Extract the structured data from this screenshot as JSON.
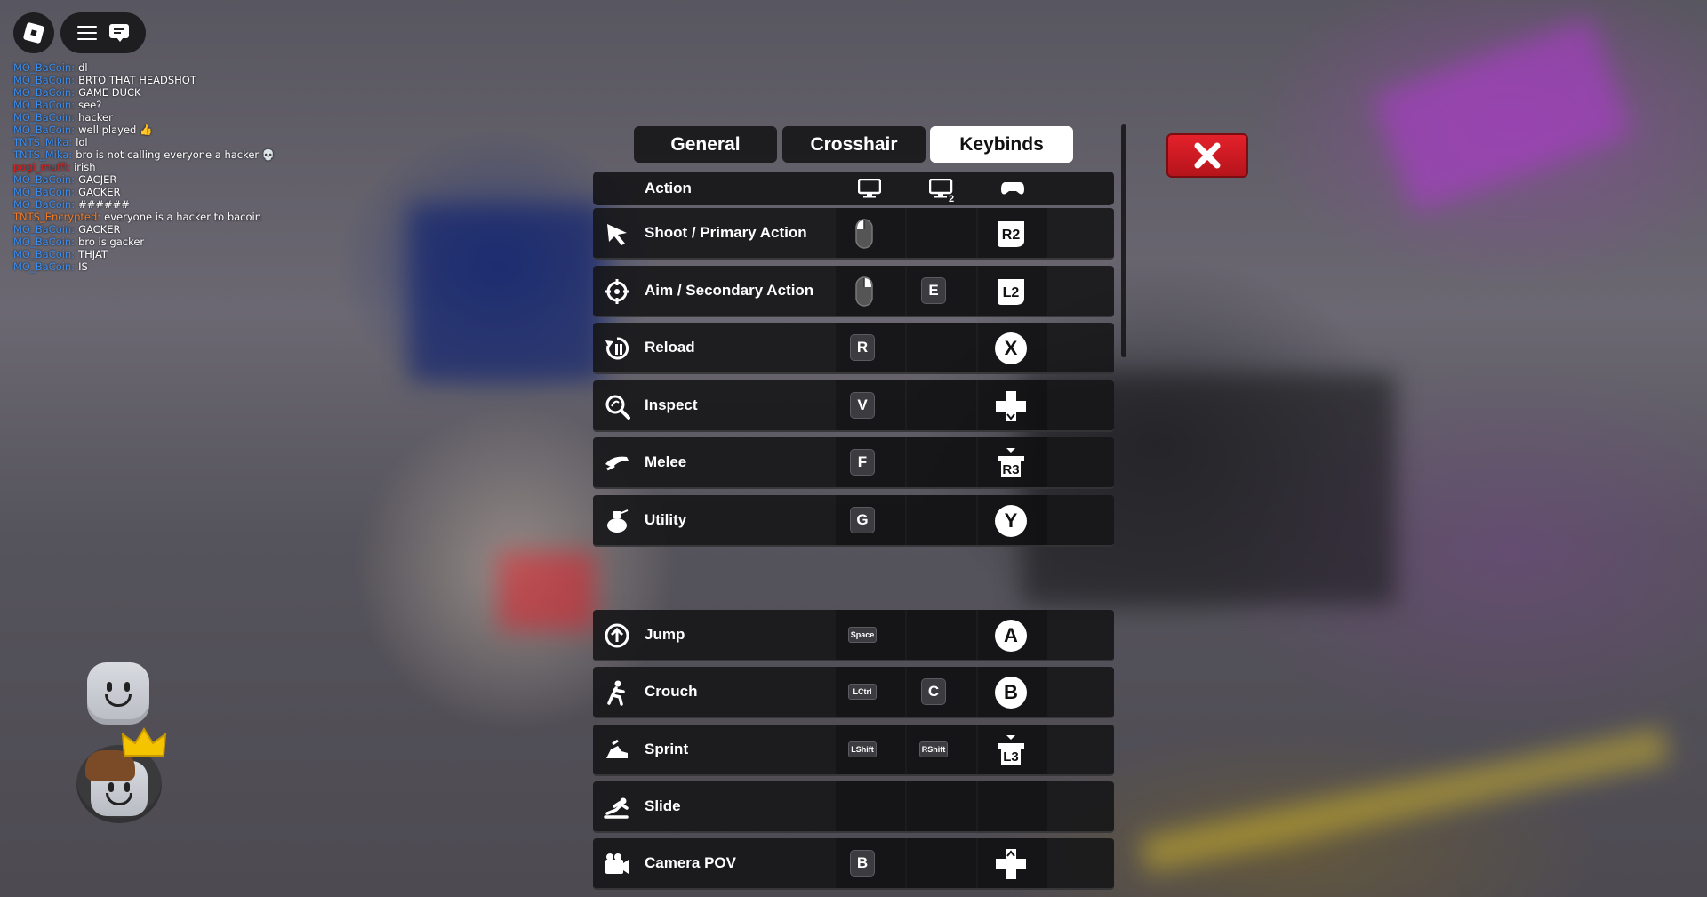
{
  "chat": [
    {
      "user": "MO_BaCoin:",
      "color": "#3a8df0",
      "text": "dl"
    },
    {
      "user": "MO_BaCoin:",
      "color": "#3a8df0",
      "text": "BRTO THAT HEADSHOT"
    },
    {
      "user": "MO_BaCoin:",
      "color": "#3a8df0",
      "text": "GAME DUCK"
    },
    {
      "user": "MO_BaCoin:",
      "color": "#3a8df0",
      "text": "see?"
    },
    {
      "user": "MO_BaCoin:",
      "color": "#3a8df0",
      "text": "hacker"
    },
    {
      "user": "MO_BaCoin:",
      "color": "#3a8df0",
      "text": "well played 👍"
    },
    {
      "user": "TNTS_Mika:",
      "color": "#3a8df0",
      "text": "lol"
    },
    {
      "user": "TNTS_Mika:",
      "color": "#3a8df0",
      "text": "bro is not calling everyone a hacker 💀"
    },
    {
      "user": "pogi_muffi:",
      "color": "#e0201e",
      "text": "irish"
    },
    {
      "user": "MO_BaCoin:",
      "color": "#3a8df0",
      "text": "GACJER"
    },
    {
      "user": "MO_BaCoin:",
      "color": "#3a8df0",
      "text": "GACKER"
    },
    {
      "user": "MO_BaCoin:",
      "color": "#3a8df0",
      "text": "######"
    },
    {
      "user": "TNTS_Encrypted:",
      "color": "#f07c2a",
      "text": "everyone is a hacker to bacoin"
    },
    {
      "user": "MO_BaCoin:",
      "color": "#3a8df0",
      "text": "GACKER"
    },
    {
      "user": "MO_BaCoin:",
      "color": "#3a8df0",
      "text": "bro is gacker"
    },
    {
      "user": "MO_BaCoin:",
      "color": "#3a8df0",
      "text": "THJAT"
    },
    {
      "user": "MO_BaCoin:",
      "color": "#3a8df0",
      "text": "IS"
    }
  ],
  "tabs": {
    "general": "General",
    "crosshair": "Crosshair",
    "keybinds": "Keybinds",
    "active": "keybinds"
  },
  "header": {
    "action_label": "Action",
    "columns": [
      "monitor-icon",
      "monitor-2-icon",
      "gamepad-icon"
    ]
  },
  "rows": [
    {
      "name": "Shoot / Primary Action",
      "icon": "shoot-icon",
      "primary": "left-mouse",
      "secondary": "",
      "gamepad": "R2"
    },
    {
      "name": "Aim / Secondary Action",
      "icon": "aim-icon",
      "primary": "right-mouse",
      "secondary": "E",
      "gamepad": "L2"
    },
    {
      "name": "Reload",
      "icon": "reload-icon",
      "primary": "R",
      "secondary": "",
      "gamepad": "X"
    },
    {
      "name": "Inspect",
      "icon": "inspect-icon",
      "primary": "V",
      "secondary": "",
      "gamepad": "dpad-down"
    },
    {
      "name": "Melee",
      "icon": "melee-icon",
      "primary": "F",
      "secondary": "",
      "gamepad": "R3"
    },
    {
      "name": "Utility",
      "icon": "utility-icon",
      "primary": "G",
      "secondary": "",
      "gamepad": "Y"
    },
    {
      "name": "Jump",
      "icon": "jump-icon",
      "primary": "Space",
      "secondary": "",
      "gamepad": "A"
    },
    {
      "name": "Crouch",
      "icon": "crouch-icon",
      "primary": "LCtrl",
      "secondary": "C",
      "gamepad": "B"
    },
    {
      "name": "Sprint",
      "icon": "sprint-icon",
      "primary": "LShift",
      "secondary": "RShift",
      "gamepad": "L3"
    },
    {
      "name": "Slide",
      "icon": "slide-icon",
      "primary": "",
      "secondary": "",
      "gamepad": ""
    },
    {
      "name": "Camera POV",
      "icon": "camera-icon",
      "primary": "B",
      "secondary": "",
      "gamepad": "dpad-up"
    }
  ],
  "colors": {
    "close_button": "#e4212b",
    "active_tab": "#ffffff"
  }
}
